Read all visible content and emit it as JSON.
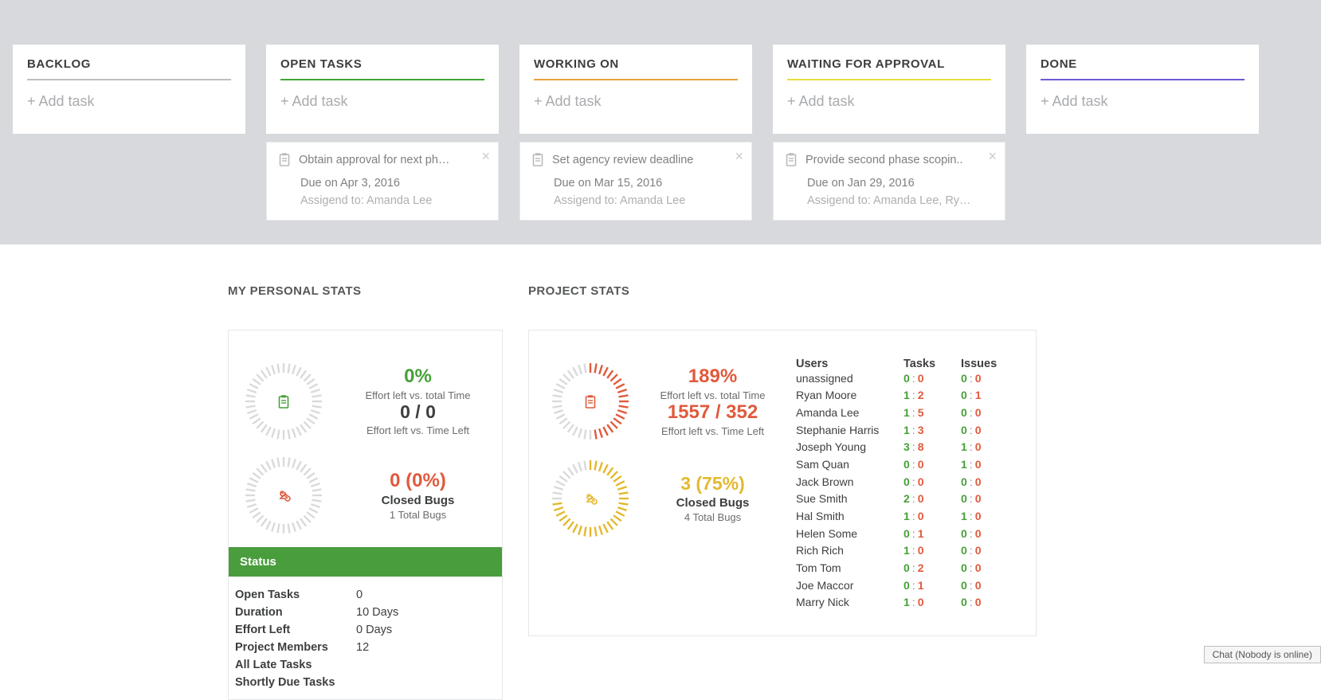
{
  "kanban": {
    "add_label": "+ Add task",
    "columns": [
      {
        "title": "BACKLOG",
        "rule": "rule-grey",
        "tasks": []
      },
      {
        "title": "OPEN TASKS",
        "rule": "rule-green",
        "tasks": [
          {
            "title": "Obtain approval for next ph…",
            "due": "Due on Apr 3, 2016",
            "assigned": "Assigend to: Amanda Lee"
          }
        ]
      },
      {
        "title": "WORKING ON",
        "rule": "rule-orange",
        "tasks": [
          {
            "title": "Set agency review deadline",
            "due": "Due on Mar 15, 2016",
            "assigned": "Assigend to: Amanda Lee"
          }
        ]
      },
      {
        "title": "WAITING FOR APPROVAL",
        "rule": "rule-yellow",
        "tasks": [
          {
            "title": "Provide second phase scopin..",
            "due": "Due on Jan 29, 2016",
            "assigned": "Assigend to: Amanda Lee, Ry…"
          }
        ]
      },
      {
        "title": "DONE",
        "rule": "rule-purple",
        "tasks": []
      }
    ]
  },
  "stats": {
    "personal_heading": "MY PERSONAL STATS",
    "project_heading": "PROJECT STATS",
    "personal": {
      "effort_pct": "0%",
      "effort_lbl1": "Effort left vs. total Time",
      "effort_ratio": "0 / 0",
      "effort_lbl2": "Effort left vs. Time Left",
      "bugs_count": "0 (0%)",
      "bugs_lbl1": "Closed Bugs",
      "bugs_lbl2": "1 Total Bugs",
      "status_title": "Status",
      "kv": [
        {
          "k": "Open Tasks",
          "v": "0"
        },
        {
          "k": "Duration",
          "v": "10 Days"
        },
        {
          "k": "Effort Left",
          "v": "0 Days"
        },
        {
          "k": "Project Members",
          "v": "12"
        },
        {
          "k": "All Late Tasks",
          "v": ""
        },
        {
          "k": "Shortly Due Tasks",
          "v": ""
        }
      ]
    },
    "project": {
      "effort_pct": "189%",
      "effort_lbl1": "Effort left vs. total Time",
      "effort_ratio": "1557 / 352",
      "effort_lbl2": "Effort left vs. Time Left",
      "bugs_count": "3 (75%)",
      "bugs_lbl1": "Closed Bugs",
      "bugs_lbl2": "4 Total Bugs",
      "table_head": {
        "users": "Users",
        "tasks": "Tasks",
        "issues": "Issues"
      },
      "rows": [
        {
          "name": "unassigned",
          "t": [
            "0",
            "0"
          ],
          "i": [
            "0",
            "0"
          ]
        },
        {
          "name": "Ryan Moore",
          "t": [
            "1",
            "2"
          ],
          "i": [
            "0",
            "1"
          ]
        },
        {
          "name": "Amanda Lee",
          "t": [
            "1",
            "5"
          ],
          "i": [
            "0",
            "0"
          ]
        },
        {
          "name": "Stephanie Harris",
          "t": [
            "1",
            "3"
          ],
          "i": [
            "0",
            "0"
          ]
        },
        {
          "name": "Joseph Young",
          "t": [
            "3",
            "8"
          ],
          "i": [
            "1",
            "0"
          ]
        },
        {
          "name": "Sam Quan",
          "t": [
            "0",
            "0"
          ],
          "i": [
            "1",
            "0"
          ]
        },
        {
          "name": "Jack Brown",
          "t": [
            "0",
            "0"
          ],
          "i": [
            "0",
            "0"
          ]
        },
        {
          "name": "Sue Smith",
          "t": [
            "2",
            "0"
          ],
          "i": [
            "0",
            "0"
          ]
        },
        {
          "name": "Hal Smith",
          "t": [
            "1",
            "0"
          ],
          "i": [
            "1",
            "0"
          ]
        },
        {
          "name": "Helen Some",
          "t": [
            "0",
            "1"
          ],
          "i": [
            "0",
            "0"
          ]
        },
        {
          "name": "Rich Rich",
          "t": [
            "1",
            "0"
          ],
          "i": [
            "0",
            "0"
          ]
        },
        {
          "name": "Tom Tom",
          "t": [
            "0",
            "2"
          ],
          "i": [
            "0",
            "0"
          ]
        },
        {
          "name": "Joe Maccor",
          "t": [
            "0",
            "1"
          ],
          "i": [
            "0",
            "0"
          ]
        },
        {
          "name": "Marry Nick",
          "t": [
            "1",
            "0"
          ],
          "i": [
            "0",
            "0"
          ]
        }
      ]
    }
  },
  "chat": {
    "label": "Chat (Nobody is online)"
  }
}
